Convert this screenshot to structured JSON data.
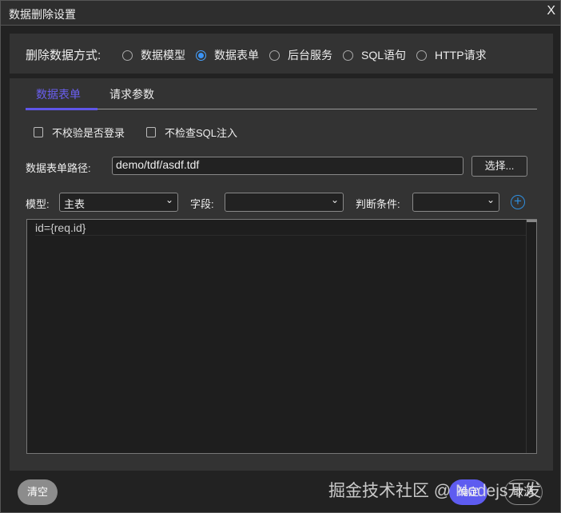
{
  "window": {
    "title": "数据删除设置",
    "close": "X"
  },
  "method": {
    "label": "删除数据方式:",
    "options": [
      {
        "label": "数据模型",
        "selected": false
      },
      {
        "label": "数据表单",
        "selected": true
      },
      {
        "label": "后台服务",
        "selected": false
      },
      {
        "label": "SQL语句",
        "selected": false
      },
      {
        "label": "HTTP请求",
        "selected": false
      }
    ]
  },
  "tabs": [
    {
      "label": "数据表单",
      "active": true
    },
    {
      "label": "请求参数",
      "active": false
    }
  ],
  "checkboxes": [
    {
      "label": "不校验是否登录",
      "checked": false
    },
    {
      "label": "不检查SQL注入",
      "checked": false
    }
  ],
  "form_path": {
    "label": "数据表单路径:",
    "value": "demo/tdf/asdf.tdf",
    "choose": "选择..."
  },
  "filters": {
    "model_label": "模型:",
    "model_value": "主表",
    "field_label": "字段:",
    "field_value": "",
    "cond_label": "判断条件:",
    "cond_value": "",
    "chevron": "⌄",
    "plus": "+"
  },
  "editor": {
    "lines": [
      "id={req.id}"
    ]
  },
  "footer": {
    "clear": "清空",
    "ok": "确定",
    "cancel": "取消"
  },
  "watermark": "掘金技术社区 @ Nodejs开发"
}
